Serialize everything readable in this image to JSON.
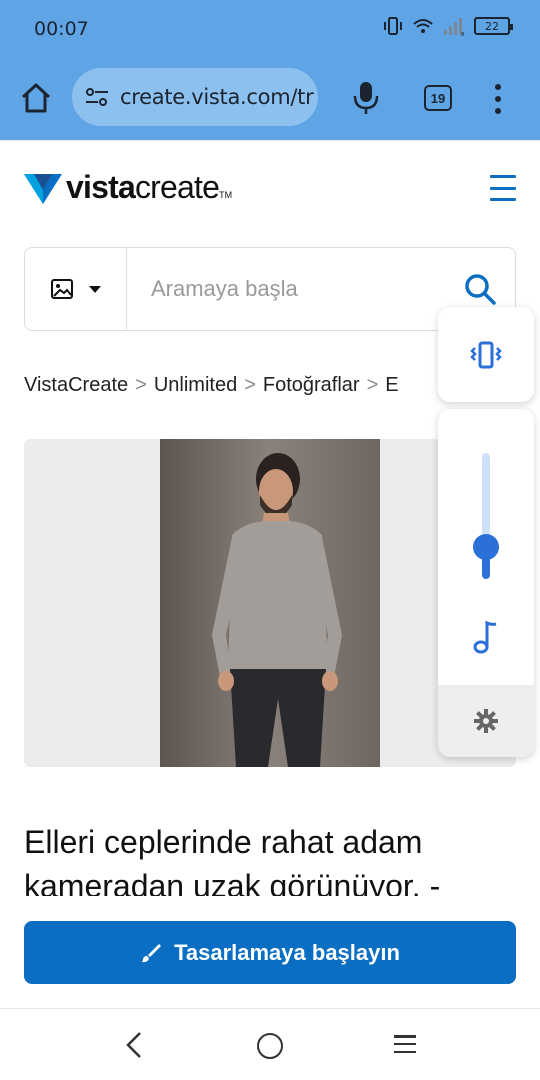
{
  "status_bar": {
    "time": "00:07",
    "battery": "22"
  },
  "browser": {
    "url": "create.vista.com/tr",
    "tab_count": "19"
  },
  "site": {
    "logo_bold": "vista",
    "logo_light": "create",
    "logo_tm": "TM"
  },
  "search": {
    "placeholder": "Aramaya başla"
  },
  "breadcrumb": {
    "items": [
      "VistaCreate",
      "Unlimited",
      "Fotoğraflar",
      "E"
    ]
  },
  "content": {
    "title": "Elleri ceplerinde rahat adam kameradan uzak görünüyor. -"
  },
  "cta": {
    "label": "Tasarlamaya başlayın"
  },
  "volume": {
    "level": 0.25
  },
  "colors": {
    "chrome_bar": "#5fa5e6",
    "brand_blue": "#0a6fc2",
    "slider_blue": "#2b6fd8"
  }
}
